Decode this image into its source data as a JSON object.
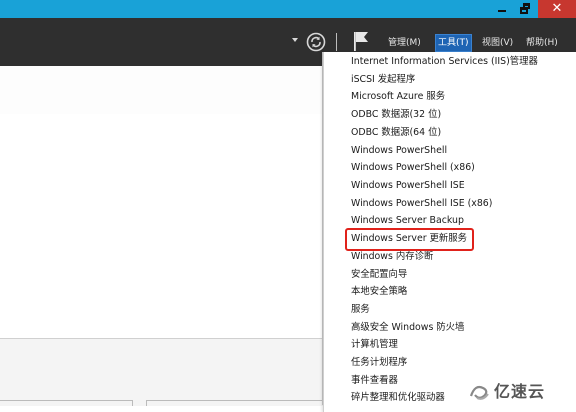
{
  "window": {
    "close_glyph": "✕"
  },
  "menubar": {
    "items": [
      {
        "label": "管理(M)"
      },
      {
        "label": "工具(T)"
      },
      {
        "label": "视图(V)"
      },
      {
        "label": "帮助(H)"
      }
    ],
    "active_index": 1
  },
  "tools_menu": {
    "items": [
      {
        "label": "Internet Information Services (IIS)管理器"
      },
      {
        "label": "iSCSI 发起程序"
      },
      {
        "label": "Microsoft Azure 服务"
      },
      {
        "label": "ODBC 数据源(32 位)"
      },
      {
        "label": "ODBC 数据源(64 位)"
      },
      {
        "label": "Windows PowerShell"
      },
      {
        "label": "Windows PowerShell (x86)"
      },
      {
        "label": "Windows PowerShell ISE"
      },
      {
        "label": "Windows PowerShell ISE (x86)"
      },
      {
        "label": "Windows Server Backup"
      },
      {
        "label": "Windows Server 更新服务"
      },
      {
        "label": "Windows 内存诊断"
      },
      {
        "label": "安全配置向导"
      },
      {
        "label": "本地安全策略"
      },
      {
        "label": "服务"
      },
      {
        "label": "高级安全 Windows 防火墙"
      },
      {
        "label": "计算机管理"
      },
      {
        "label": "任务计划程序"
      },
      {
        "label": "事件查看器"
      },
      {
        "label": "碎片整理和优化驱动器"
      }
    ],
    "highlighted_index": 10
  },
  "watermark": {
    "text": "亿速云"
  },
  "colors": {
    "titlebar": "#19a2d7",
    "header": "#2f2f2f",
    "active_menu": "#1e64b4",
    "highlight_box": "#e0221b",
    "close_button": "#c7372f"
  }
}
